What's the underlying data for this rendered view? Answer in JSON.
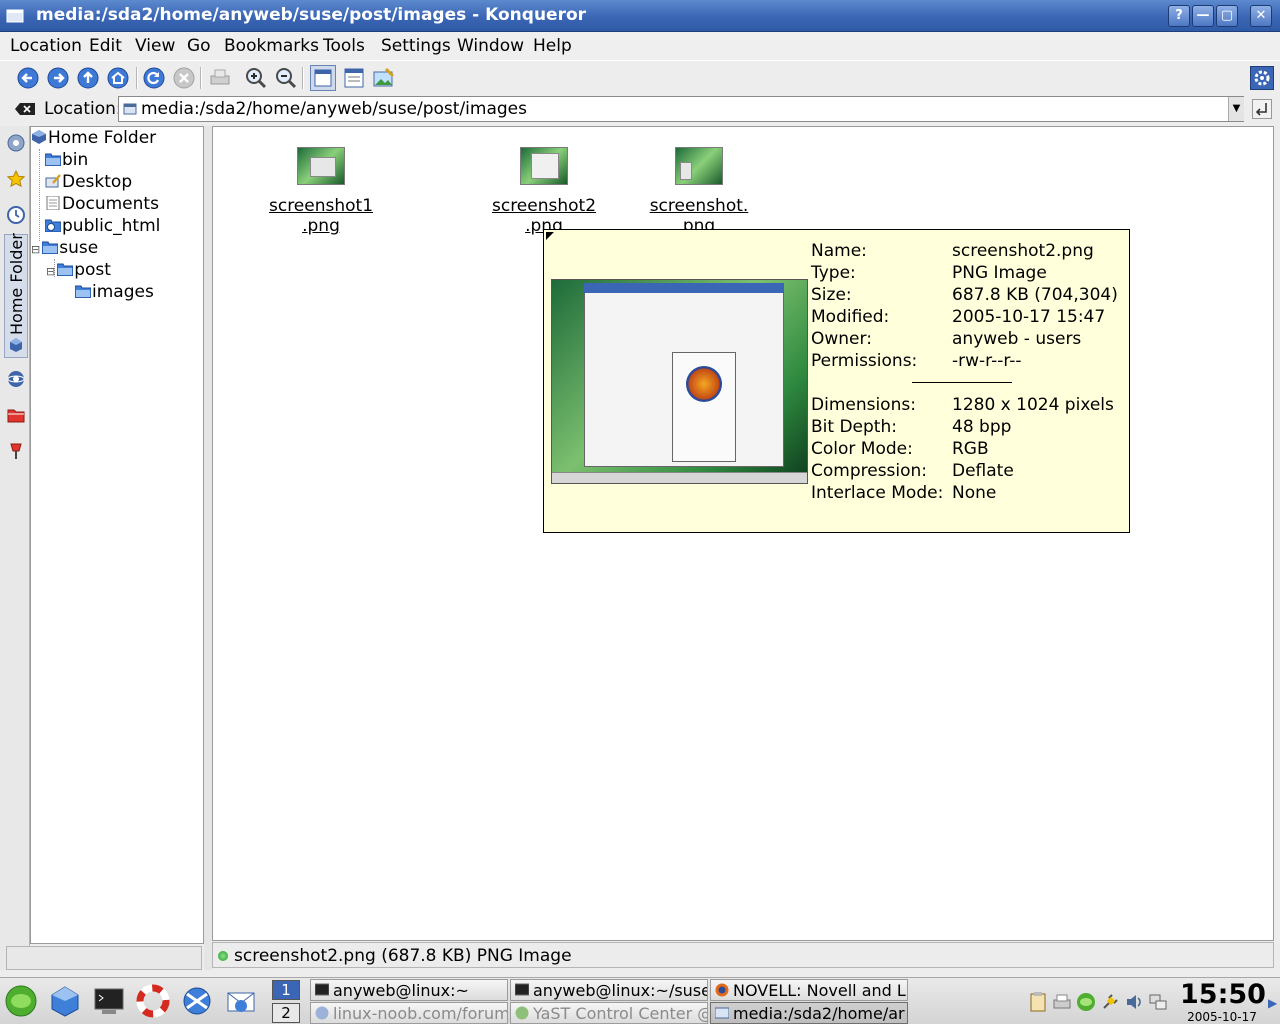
{
  "window": {
    "title": "media:/sda2/home/anyweb/suse/post/images - Konqueror",
    "buttons": {
      "help": "?",
      "minimize": "—",
      "maximize": "▢",
      "close": "✕"
    }
  },
  "menu": [
    "Location",
    "Edit",
    "View",
    "Go",
    "Bookmarks",
    "Tools",
    "Settings",
    "Window",
    "Help"
  ],
  "toolbar": {
    "icons": [
      "back-icon",
      "forward-icon",
      "up-icon",
      "home-icon",
      "reload-icon",
      "stop-icon",
      "print-icon",
      "zoom-in-icon",
      "zoom-out-icon",
      "icon-view-icon",
      "detailed-view-icon",
      "image-preview-icon",
      "konqueror-gear-icon"
    ]
  },
  "location": {
    "label": "Location:",
    "value": "media:/sda2/home/anyweb/suse/post/images"
  },
  "sidebar": {
    "vertical_tab": "Home Folder",
    "tree": [
      {
        "label": "Home Folder",
        "depth": 0
      },
      {
        "label": "bin",
        "depth": 1
      },
      {
        "label": "Desktop",
        "depth": 1
      },
      {
        "label": "Documents",
        "depth": 1
      },
      {
        "label": "public_html",
        "depth": 1
      },
      {
        "label": "suse",
        "depth": 1,
        "expander": "⊟"
      },
      {
        "label": "post",
        "depth": 2,
        "expander": "⊟"
      },
      {
        "label": "images",
        "depth": 3
      }
    ]
  },
  "files": [
    {
      "name": "screenshot1.png",
      "line1": "screenshot1",
      "line2": ".png"
    },
    {
      "name": "screenshot2.png",
      "line1": "screenshot2",
      "line2": ".png"
    },
    {
      "name": "screenshot.png",
      "line1": "screenshot.",
      "line2": "png"
    }
  ],
  "tooltip": {
    "rows": [
      {
        "k": "Name:",
        "v": "screenshot2.png"
      },
      {
        "k": "Type:",
        "v": "PNG Image"
      },
      {
        "k": "Size:",
        "v": "687.8 KB (704,304)"
      },
      {
        "k": "Modified:",
        "v": "2005-10-17 15:47"
      },
      {
        "k": "Owner:",
        "v": "anyweb - users"
      },
      {
        "k": "Permissions:",
        "v": "-rw-r--r--"
      },
      {
        "k": "Dimensions:",
        "v": "1280 x 1024 pixels"
      },
      {
        "k": "Bit Depth:",
        "v": "48 bpp"
      },
      {
        "k": "Color Mode:",
        "v": "RGB"
      },
      {
        "k": "Compression:",
        "v": "Deflate"
      },
      {
        "k": "Interlace Mode:",
        "v": "None"
      }
    ]
  },
  "statusbar": {
    "text": "screenshot2.png (687.8 KB)  PNG Image"
  },
  "taskbar": {
    "desktops": [
      "1",
      "2"
    ],
    "tasks": [
      {
        "label": "anyweb@linux:~",
        "state": "normal"
      },
      {
        "label": "anyweb@linux:~/suse/",
        "state": "normal"
      },
      {
        "label": "NOVELL: Novell and Li",
        "state": "normal"
      },
      {
        "label": "linux-noob.com/forums",
        "state": "dim"
      },
      {
        "label": "YaST Control Center @",
        "state": "dim"
      },
      {
        "label": "media:/sda2/home/ar",
        "state": "active"
      }
    ],
    "clock": {
      "time": "15:50",
      "date": "2005-10-17"
    }
  },
  "colors": {
    "titlebar": "#3a66b5",
    "tooltip_bg": "#ffffdc",
    "selection": "#4a78c8"
  }
}
